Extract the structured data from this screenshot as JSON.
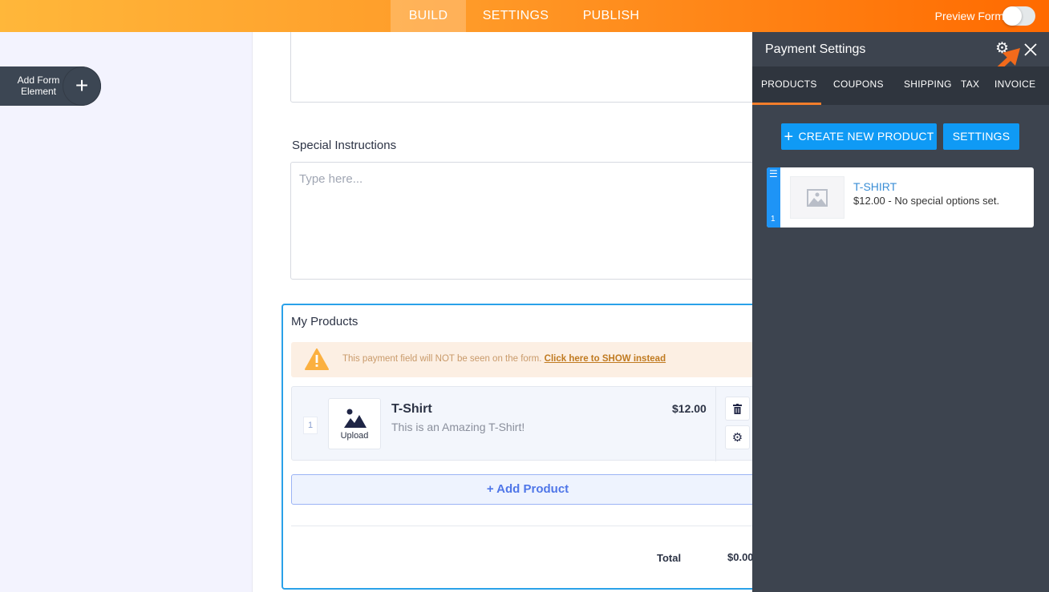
{
  "topbar": {
    "tabs": [
      "BUILD",
      "SETTINGS",
      "PUBLISH"
    ],
    "active_tab": "BUILD",
    "preview_label": "Preview Form",
    "preview_on": false
  },
  "sidebar": {
    "add_element_label": "Add Form Element"
  },
  "form": {
    "special_instructions_label": "Special Instructions",
    "special_instructions_placeholder": "Type here...",
    "products_label": "My Products",
    "warning_text": "This payment field will NOT be seen on the form.",
    "warning_link": "Click here to SHOW instead",
    "product": {
      "index": "1",
      "upload_label": "Upload",
      "name": "T-Shirt",
      "description": "This is an Amazing T-Shirt!",
      "price": "$12.00"
    },
    "add_product_label": "+ Add Product",
    "total_label": "Total",
    "total_value": "$0.00"
  },
  "panel": {
    "title": "Payment Settings",
    "tabs": [
      "PRODUCTS",
      "COUPONS",
      "SHIPPING",
      "TAX",
      "INVOICE"
    ],
    "active_tab": "PRODUCTS",
    "create_label": "CREATE NEW PRODUCT",
    "settings_label": "SETTINGS",
    "products": [
      {
        "index": "1",
        "name": "T-SHIRT",
        "detail": "$12.00 - No special options set."
      }
    ]
  },
  "colors": {
    "accent": "#ff6a00",
    "panel_bg": "#3d444f",
    "button_blue": "#0f9af5",
    "tab_underline": "#f47e2b"
  }
}
